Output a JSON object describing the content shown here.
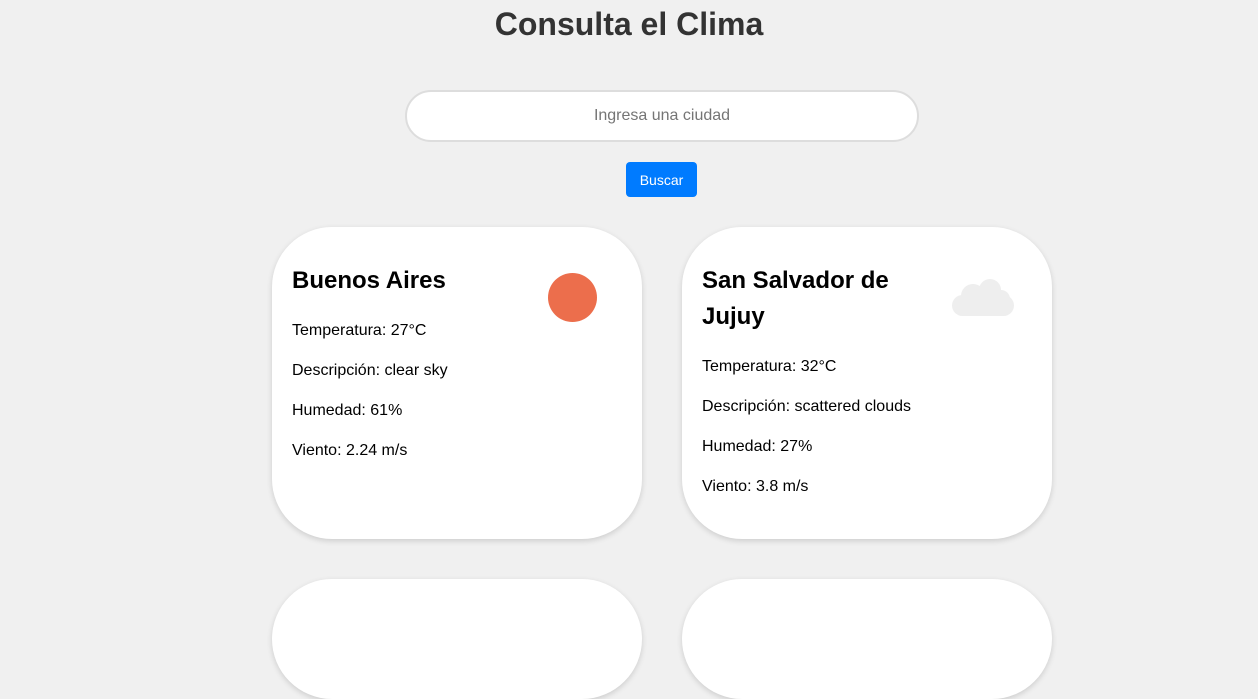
{
  "header": {
    "title": "Consulta el Clima"
  },
  "search": {
    "placeholder": "Ingresa una ciudad",
    "value": "",
    "button_label": "Buscar"
  },
  "colors": {
    "background": "#f0f0f0",
    "title": "#333333",
    "button": "#007bff",
    "sun": "#ec6e4c",
    "cloud": "#eeeeee"
  },
  "cards": [
    {
      "city": "Buenos Aires",
      "icon": "sun-icon",
      "temperature": "Temperatura: 27°C",
      "description": "Descripción: clear sky",
      "humidity": "Humedad: 61%",
      "wind": "Viento: 2.24 m/s"
    },
    {
      "city": "San Salvador de Jujuy",
      "icon": "cloud-icon",
      "temperature": "Temperatura: 32°C",
      "description": "Descripción: scattered clouds",
      "humidity": "Humedad: 27%",
      "wind": "Viento: 3.8 m/s"
    }
  ]
}
